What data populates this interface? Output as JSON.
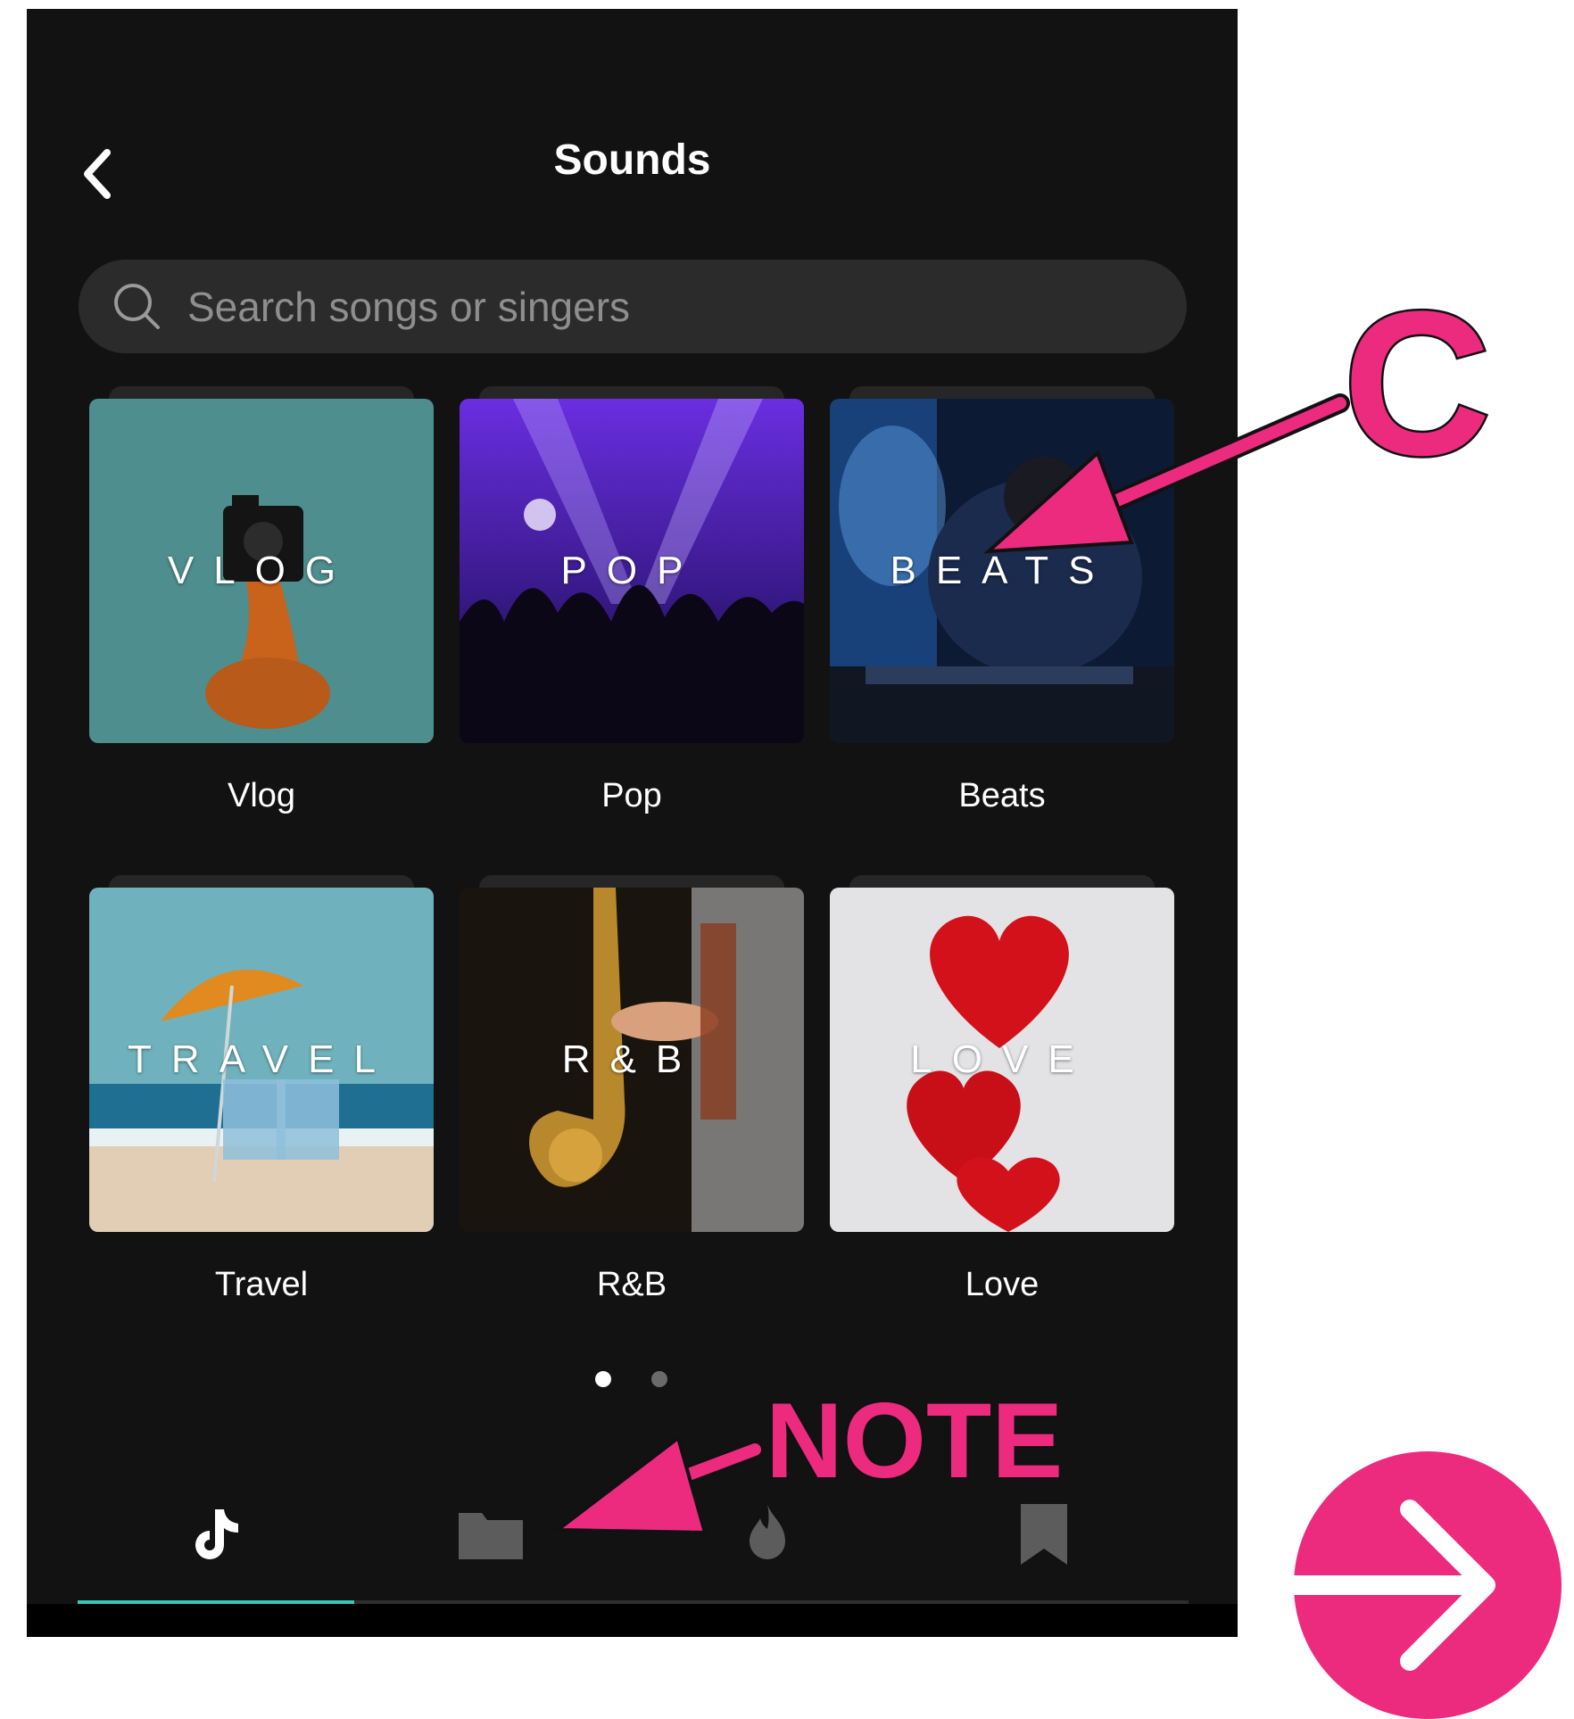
{
  "header": {
    "title": "Sounds"
  },
  "search": {
    "placeholder": "Search songs or singers"
  },
  "categories": [
    {
      "overlay": "VLOG",
      "label": "Vlog"
    },
    {
      "overlay": "POP",
      "label": "Pop"
    },
    {
      "overlay": "BEATS",
      "label": "Beats"
    },
    {
      "overlay": "TRAVEL",
      "label": "Travel"
    },
    {
      "overlay": "R&B",
      "label": "R&B"
    },
    {
      "overlay": "LOVE",
      "label": "Love"
    }
  ],
  "pagination": {
    "pages": 2,
    "current": 1
  },
  "bottom_nav": [
    "tiktok-icon",
    "folder-icon",
    "flame-icon",
    "bookmark-icon"
  ],
  "annotations": {
    "callout_c": "C",
    "callout_note": "NOTE"
  },
  "colors": {
    "accent": "#ec2a7e",
    "tab_underline": "#37c9b4",
    "background": "#121212"
  }
}
